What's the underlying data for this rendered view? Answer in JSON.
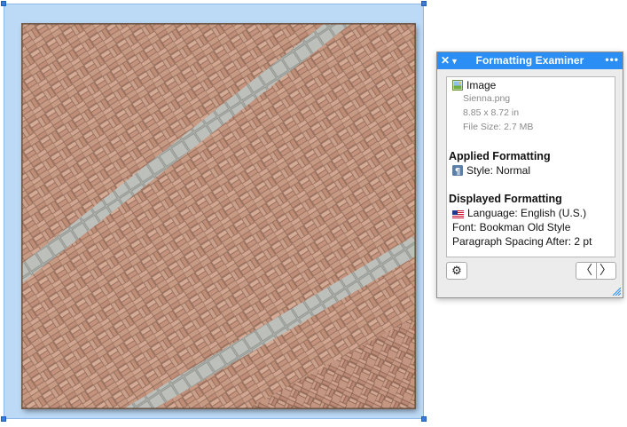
{
  "canvas": {
    "image_alt": "Sienna brick herringbone pavement",
    "selection_color": "#bcd9f6",
    "handle_color": "#3a7bd5"
  },
  "panel": {
    "title": "Formatting Examiner",
    "title_bar_color": "#2a8ef5",
    "close_glyph": "✕",
    "collapse_glyph": "▼",
    "more_glyph": "•••",
    "object": {
      "type_label": "Image",
      "file_name": "Sienna.png",
      "dimensions": "8.85 x 8.72 in",
      "file_size": "File Size: 2.7 MB"
    },
    "applied": {
      "heading": "Applied Formatting",
      "style": "Style: Normal"
    },
    "displayed": {
      "heading": "Displayed Formatting",
      "language": "Language: English (U.S.)",
      "font": "Font: Bookman Old Style",
      "spacing": "Paragraph Spacing After: 2 pt"
    },
    "buttons": {
      "gear_icon": "gear-icon",
      "prev_glyph": "〈",
      "next_glyph": "〉"
    }
  }
}
